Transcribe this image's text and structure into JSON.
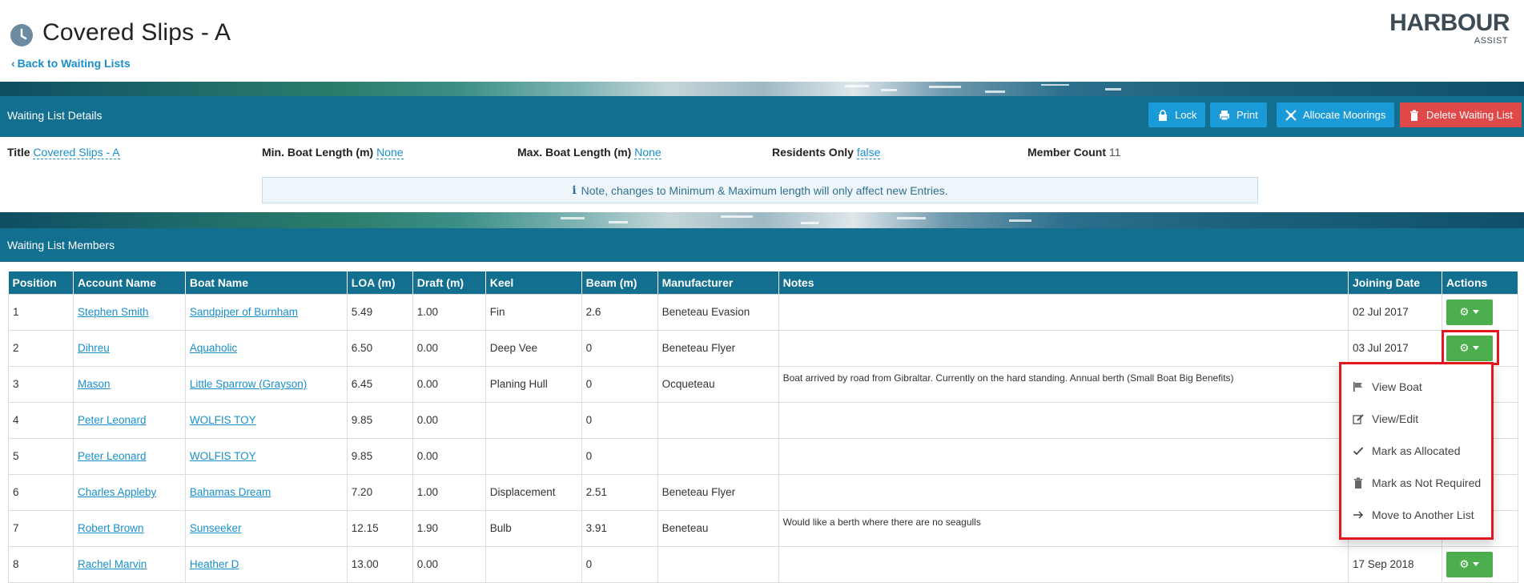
{
  "header": {
    "title": "Covered Slips - A",
    "back_link": "Back to Waiting Lists",
    "logo_word": "HARBOUR",
    "logo_sub": "ASSIST"
  },
  "details_section": {
    "title": "Waiting List Details",
    "buttons": {
      "lock": "Lock",
      "print": "Print",
      "allocate": "Allocate Moorings",
      "delete": "Delete Waiting List"
    },
    "fields": {
      "title_label": "Title",
      "title_value": "Covered Slips - A",
      "min_label": "Min. Boat Length (m)",
      "min_value": "None",
      "max_label": "Max. Boat Length (m)",
      "max_value": "None",
      "residents_label": "Residents Only",
      "residents_value": "false",
      "member_label": "Member Count",
      "member_value": "11"
    },
    "note": "Note, changes to Minimum & Maximum length will only affect new Entries."
  },
  "members_section": {
    "title": "Waiting List Members",
    "columns": [
      "Position",
      "Account Name",
      "Boat Name",
      "LOA (m)",
      "Draft (m)",
      "Keel",
      "Beam (m)",
      "Manufacturer",
      "Notes",
      "Joining Date",
      "Actions"
    ],
    "rows": [
      {
        "pos": "1",
        "account": "Stephen Smith",
        "boat": "Sandpiper of Burnham",
        "loa": "5.49",
        "draft": "1.00",
        "keel": "Fin",
        "beam": "2.6",
        "manufacturer": "Beneteau Evasion",
        "notes": "",
        "date": "02 Jul 2017"
      },
      {
        "pos": "2",
        "account": "Dihreu",
        "boat": "Aquaholic",
        "loa": "6.50",
        "draft": "0.00",
        "keel": "Deep Vee",
        "beam": "0",
        "manufacturer": "Beneteau Flyer",
        "notes": "",
        "date": "03 Jul 2017"
      },
      {
        "pos": "3",
        "account": "Mason",
        "boat": "Little Sparrow (Grayson)",
        "loa": "6.45",
        "draft": "0.00",
        "keel": "Planing Hull",
        "beam": "0",
        "manufacturer": "Ocqueteau",
        "notes": "Boat arrived by road from Gibraltar. Currently on the hard standing. Annual berth (Small Boat Big Benefits)",
        "date": ""
      },
      {
        "pos": "4",
        "account": "Peter Leonard",
        "boat": "WOLFIS TOY",
        "loa": "9.85",
        "draft": "0.00",
        "keel": "",
        "beam": "0",
        "manufacturer": "",
        "notes": "",
        "date": ""
      },
      {
        "pos": "5",
        "account": "Peter Leonard",
        "boat": "WOLFIS TOY",
        "loa": "9.85",
        "draft": "0.00",
        "keel": "",
        "beam": "0",
        "manufacturer": "",
        "notes": "",
        "date": ""
      },
      {
        "pos": "6",
        "account": "Charles Appleby",
        "boat": "Bahamas Dream",
        "loa": "7.20",
        "draft": "1.00",
        "keel": "Displacement",
        "beam": "2.51",
        "manufacturer": "Beneteau Flyer",
        "notes": "",
        "date": ""
      },
      {
        "pos": "7",
        "account": "Robert Brown",
        "boat": "Sunseeker",
        "loa": "12.15",
        "draft": "1.90",
        "keel": "Bulb",
        "beam": "3.91",
        "manufacturer": "Beneteau",
        "notes": "Would like a berth where there are no seagulls",
        "date": ""
      },
      {
        "pos": "8",
        "account": "Rachel Marvin",
        "boat": "Heather D",
        "loa": "13.00",
        "draft": "0.00",
        "keel": "",
        "beam": "0",
        "manufacturer": "",
        "notes": "",
        "date": "17 Sep 2018"
      }
    ]
  },
  "dropdown": {
    "items": [
      "View Boat",
      "View/Edit",
      "Mark as Allocated",
      "Mark as Not Required",
      "Move to Another List"
    ]
  },
  "colors": {
    "primary": "#126f8f",
    "link": "#1a8fc9",
    "button_blue": "#1b9ad8",
    "button_red": "#e0494a",
    "action_green": "#4cae4c",
    "highlight_red": "#e3171e"
  }
}
